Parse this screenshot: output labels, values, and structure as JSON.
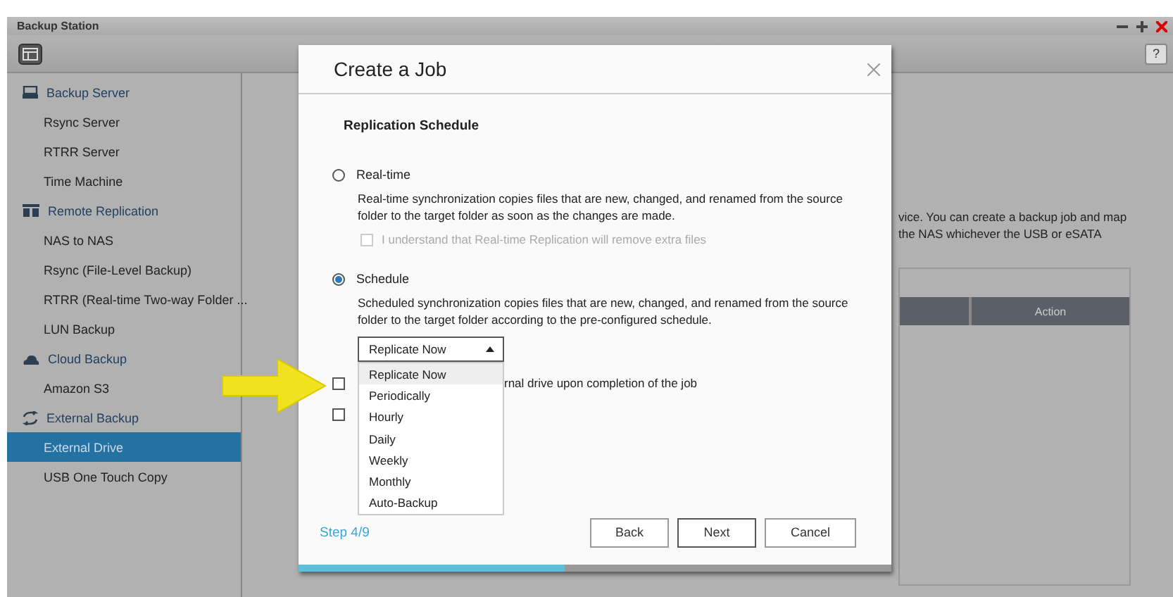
{
  "window": {
    "title": "Backup Station"
  },
  "toolbar": {
    "help": "?"
  },
  "sidebar": [
    {
      "label": "Backup Server",
      "kind": "server",
      "children": [
        {
          "label": "Rsync Server",
          "selected": false
        },
        {
          "label": "RTRR Server",
          "selected": false
        },
        {
          "label": "Time Machine",
          "selected": false
        }
      ]
    },
    {
      "label": "Remote Replication",
      "kind": "replication",
      "children": [
        {
          "label": "NAS to NAS",
          "selected": false
        },
        {
          "label": "Rsync (File-Level Backup)",
          "selected": false
        },
        {
          "label": "RTRR (Real-time Two-way Folder ...",
          "selected": false
        },
        {
          "label": "LUN Backup",
          "selected": false
        }
      ]
    },
    {
      "label": "Cloud Backup",
      "kind": "cloud",
      "children": [
        {
          "label": "Amazon S3",
          "selected": false
        }
      ]
    },
    {
      "label": "External Backup",
      "kind": "sync",
      "children": [
        {
          "label": "External Drive",
          "selected": true
        },
        {
          "label": "USB One Touch Copy",
          "selected": false
        }
      ]
    }
  ],
  "background": {
    "lines": [
      "vice. You can create a backup job and map",
      "the NAS whichever the USB or eSATA"
    ],
    "table": {
      "columns": [
        "Action"
      ]
    }
  },
  "dialog": {
    "title": "Create a Job",
    "section": "Replication Schedule",
    "modes": [
      {
        "label": "Real-time",
        "selected": false,
        "description": "Real-time synchronization copies files that are new, changed, and renamed from the source folder to the target folder as soon as the changes are made.",
        "confirm": {
          "label": "I understand that Real-time Replication will remove extra files",
          "checked": false,
          "disabled": true
        }
      },
      {
        "label": "Schedule",
        "selected": true,
        "description": "Scheduled synchronization copies files that are new, changed, and renamed from the source folder to the target folder according to the pre-configured schedule.",
        "select": {
          "value": "Replicate Now",
          "expanded": true,
          "options": [
            {
              "label": "Replicate Now",
              "selected": true
            },
            {
              "label": "Periodically",
              "selected": false
            },
            {
              "label": "Hourly",
              "selected": false
            },
            {
              "label": "Daily",
              "selected": false
            },
            {
              "label": "Weekly",
              "selected": false
            },
            {
              "label": "Monthly",
              "selected": false
            },
            {
              "label": "Auto-Backup",
              "selected": false
            }
          ]
        }
      }
    ],
    "checkboxes": [
      {
        "label": "rnal drive upon completion of the job",
        "checked": false
      },
      {
        "checked": false
      }
    ],
    "step": "Step 4/9",
    "buttons": [
      "Back",
      "Next",
      "Cancel"
    ],
    "progress": {
      "level": 0.45
    }
  }
}
